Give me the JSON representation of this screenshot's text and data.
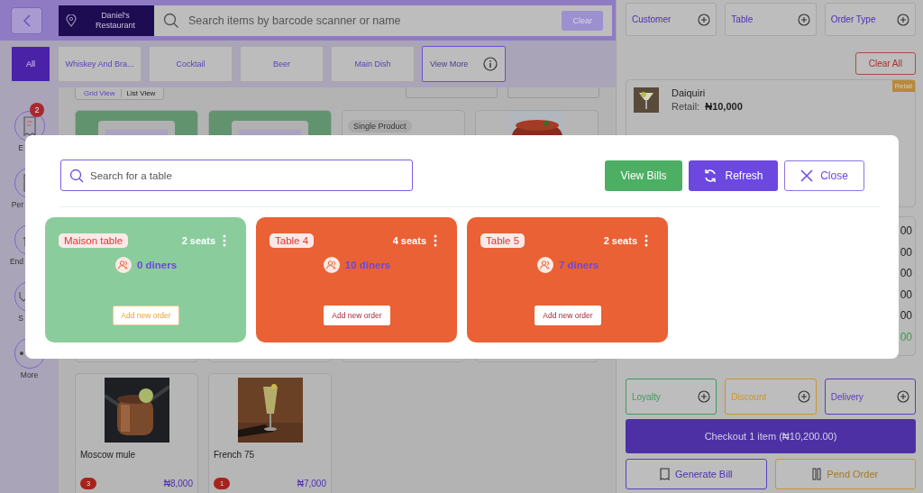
{
  "header": {
    "location": "Daniel's Restaurant",
    "search": {
      "placeholder": "Search items by barcode scanner or name"
    },
    "clear_button": "Clear"
  },
  "categories": [
    {
      "label": "All",
      "kind": "category",
      "selected": true
    },
    {
      "label": "Whiskey And Bra...",
      "kind": "category",
      "selected": false
    },
    {
      "label": "Cocktail",
      "kind": "category",
      "selected": false
    },
    {
      "label": "Beer",
      "kind": "category",
      "selected": false
    },
    {
      "label": "Main Dish",
      "kind": "category",
      "selected": false
    },
    {
      "label": "View More",
      "kind": "more",
      "selected": false
    }
  ],
  "view_toggle": [
    {
      "label": "Grid View",
      "selected": true
    },
    {
      "label": "List View",
      "selected": false
    }
  ],
  "sidebar": [
    {
      "label": "E",
      "badge": "2"
    },
    {
      "label": "Per"
    },
    {
      "label": "End"
    },
    {
      "label": "S"
    },
    {
      "label": "More"
    }
  ],
  "products_top": [
    {
      "kind": "placeholder"
    },
    {
      "kind": "placeholder"
    },
    {
      "kind": "tag",
      "tag": "Single Product"
    },
    {
      "kind": "picture"
    }
  ],
  "products": [
    {
      "name": "Moscow mule",
      "count": "3",
      "price": "₦8,000"
    },
    {
      "name": "French 75",
      "count": "1",
      "price": "₦7,000"
    }
  ],
  "cart": {
    "top_buttons": [
      "Customer",
      "Table",
      "Order Type"
    ],
    "clear_button": "Clear All",
    "item": {
      "name": "Daiquiri",
      "price_label": "Retail:",
      "price": "₦10,000",
      "tag": "Retail"
    },
    "totals": [
      {
        "value": "00",
        "kind": "normal"
      },
      {
        "value": "00",
        "kind": "normal"
      },
      {
        "value": "00",
        "kind": "normal"
      },
      {
        "value": "00",
        "kind": "normal"
      },
      {
        "value": "00",
        "kind": "normal"
      },
      {
        "value": "00",
        "kind": "total"
      }
    ],
    "extras": [
      {
        "label": "Loyalty",
        "color": "#3f9a5a"
      },
      {
        "label": "Discount",
        "color": "#c9952f"
      },
      {
        "label": "Delivery",
        "color": "#5a3fc0"
      }
    ],
    "checkout": "Checkout 1 item (₦10,200.00)",
    "actions": [
      {
        "label": "Generate Bill",
        "kind": "bill"
      },
      {
        "label": "Pend Order",
        "kind": "pend"
      }
    ]
  },
  "modal": {
    "search": {
      "placeholder": "Search for a table"
    },
    "buttons": [
      {
        "label": "View Bills",
        "kind": "bills"
      },
      {
        "label": "Refresh",
        "kind": "refresh"
      },
      {
        "label": "Close",
        "kind": "close"
      }
    ],
    "tables": [
      {
        "name": "Maison table",
        "seats": "2 seats",
        "diners": "0 diners",
        "occupied": false,
        "action": "Add new order"
      },
      {
        "name": "Table 4",
        "seats": "4 seats",
        "diners": "10 diners",
        "occupied": true,
        "action": "Add new order"
      },
      {
        "name": "Table 5",
        "seats": "2 seats",
        "diners": "7 diners",
        "occupied": true,
        "action": "Add new order"
      }
    ]
  }
}
